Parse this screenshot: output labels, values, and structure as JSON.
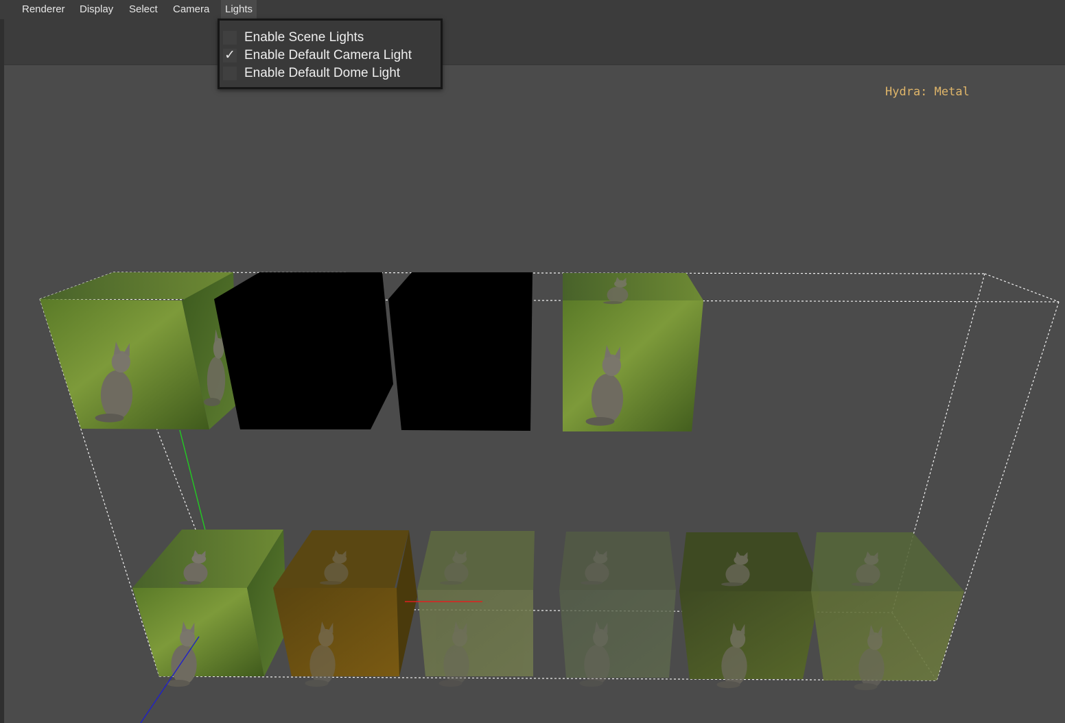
{
  "menubar": {
    "items": [
      {
        "label": "Renderer"
      },
      {
        "label": "Display"
      },
      {
        "label": "Select"
      },
      {
        "label": "Camera"
      },
      {
        "label": "Lights"
      }
    ]
  },
  "lights_menu": {
    "items": [
      {
        "label": "Enable Scene Lights",
        "checked": false
      },
      {
        "label": "Enable Default Camera Light",
        "checked": true
      },
      {
        "label": "Enable Default Dome Light",
        "checked": false
      }
    ],
    "check_glyph": "✓"
  },
  "viewport": {
    "renderer_label": "Hydra: Metal",
    "colors": {
      "background": "#4b4b4b",
      "renderer_label": "#e0b66a",
      "bbox": "#ffffff",
      "axis_x": "#e02020",
      "axis_y": "#20c020",
      "axis_z": "#2020c0"
    }
  }
}
